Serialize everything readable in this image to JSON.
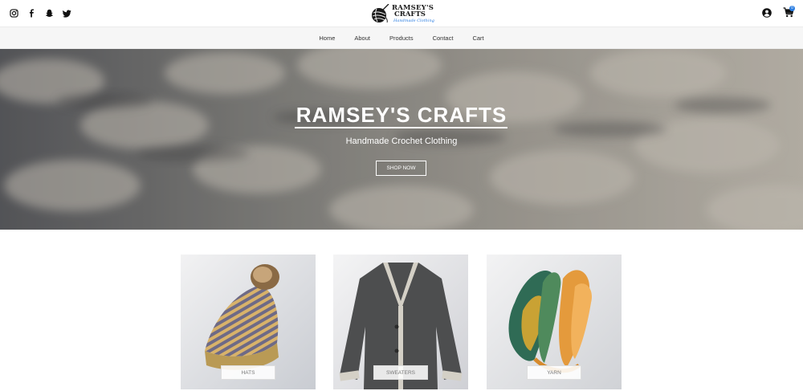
{
  "header": {
    "logo": {
      "line1": "RAMSEY'S",
      "line2": "CRAFTS",
      "tagline": "Handmade Clothing"
    },
    "social_icons": [
      "instagram-icon",
      "facebook-icon",
      "snapchat-icon",
      "twitter-icon"
    ],
    "cart_count": "0"
  },
  "nav": {
    "items": [
      {
        "label": "Home"
      },
      {
        "label": "About"
      },
      {
        "label": "Products"
      },
      {
        "label": "Contact"
      },
      {
        "label": "Cart"
      }
    ]
  },
  "hero": {
    "title": "RAMSEY'S CRAFTS",
    "subtitle": "Handmade Crochet Clothing",
    "button_label": "SHOP NOW"
  },
  "categories": [
    {
      "label": "HATS"
    },
    {
      "label": "SWEATERS"
    },
    {
      "label": "YARN"
    }
  ],
  "colors": {
    "accent": "#2a7de1",
    "nav_background": "#f6f6f6"
  }
}
